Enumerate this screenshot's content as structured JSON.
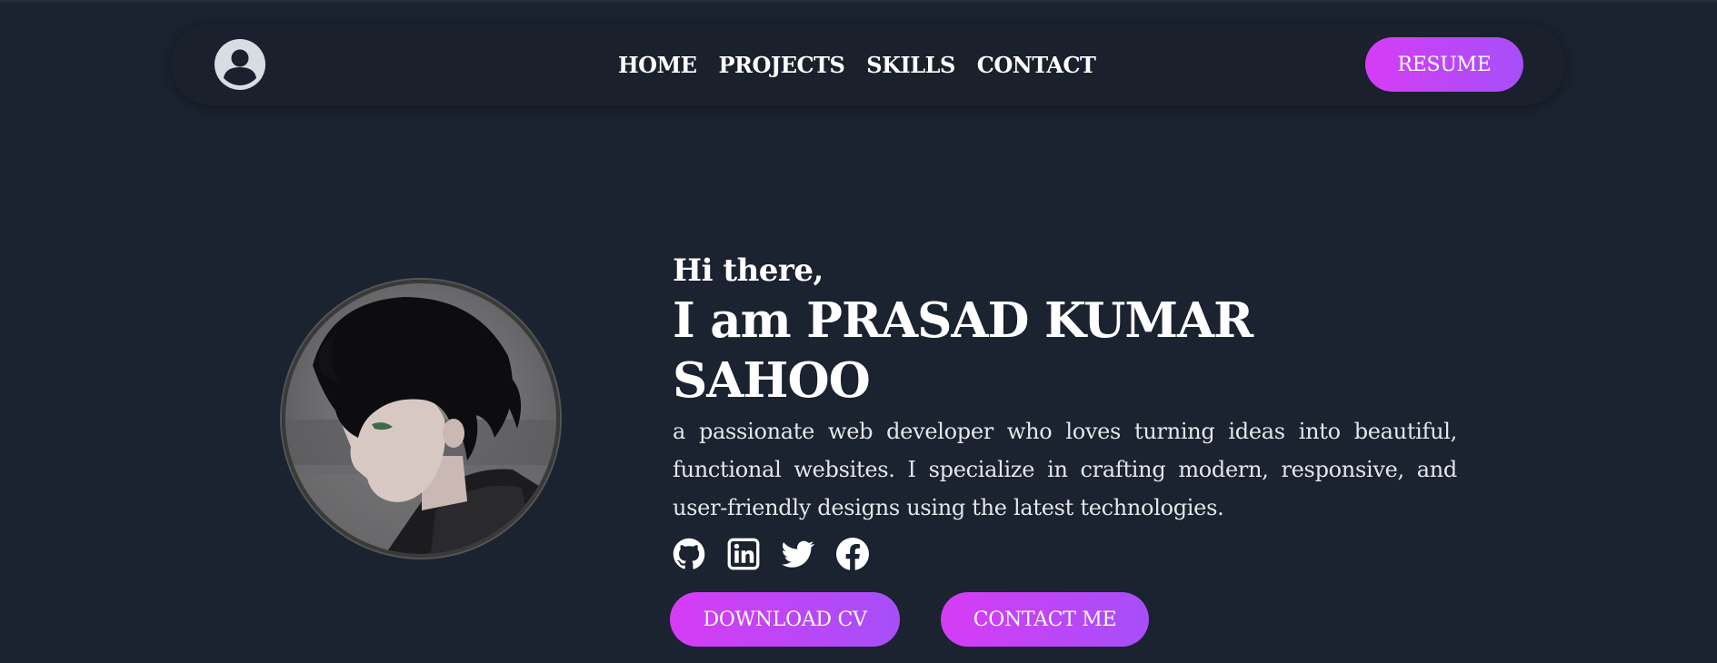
{
  "nav": {
    "links": [
      "HOME",
      "PROJECTS",
      "SKILLS",
      "CONTACT"
    ],
    "resume_label": "RESUME"
  },
  "hero": {
    "greeting": "Hi there,",
    "name": "I am PRASAD KUMAR SAHOO",
    "bio": "a passionate web developer who loves turning ideas into beautiful, functional websites. I specialize in crafting modern, responsive, and user-friendly designs using the latest technologies.",
    "socials": [
      "github-icon",
      "linkedin-icon",
      "twitter-icon",
      "facebook-icon"
    ],
    "download_label": "DOWNLOAD CV",
    "contact_label": "CONTACT ME"
  },
  "colors": {
    "background": "#1b2230",
    "navbar": "#1a202c",
    "gradient_start": "#d63cf6",
    "gradient_end": "#a64ff8"
  }
}
